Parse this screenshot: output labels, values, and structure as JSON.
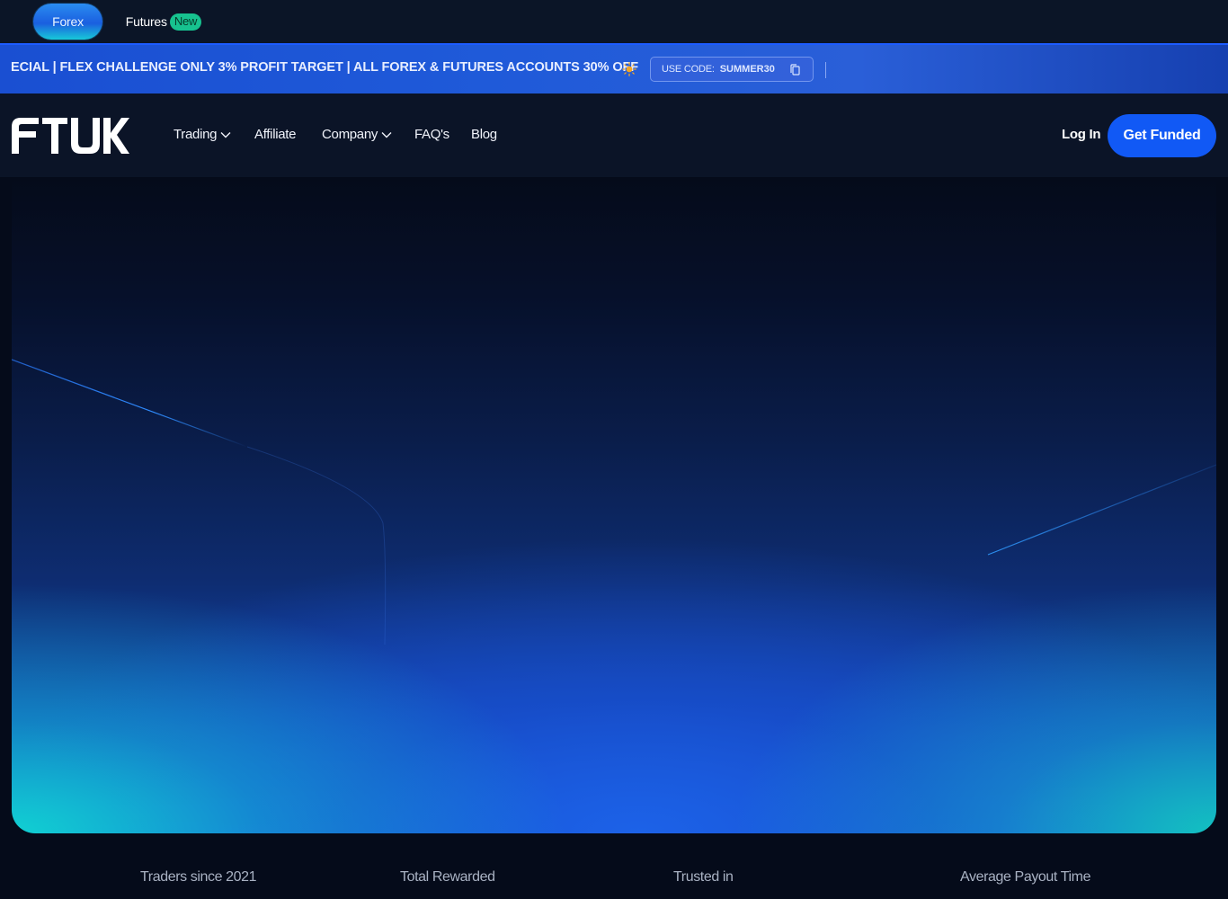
{
  "market_switcher": {
    "forex_label": "Forex",
    "futures_label": "Futures",
    "new_badge": "New"
  },
  "promo": {
    "text": "ECIAL | FLEX CHALLENGE ONLY 3% PROFIT TARGET | ALL FOREX & FUTURES ACCOUNTS 30% OFF",
    "code_label": "USE CODE:",
    "code_value": "SUMMER30",
    "sun_icon": "sun-icon",
    "copy_icon": "copy-icon"
  },
  "nav": {
    "logo_text": "FTUK",
    "items": [
      {
        "label": "Trading",
        "has_dropdown": true
      },
      {
        "label": "Affiliate",
        "has_dropdown": false
      },
      {
        "label": "Company",
        "has_dropdown": true
      },
      {
        "label": "FAQ's",
        "has_dropdown": false
      },
      {
        "label": "Blog",
        "has_dropdown": false
      }
    ],
    "login_label": "Log In",
    "cta_label": "Get Funded"
  },
  "stats": [
    {
      "label": "Traders since 2021"
    },
    {
      "label": "Total Rewarded"
    },
    {
      "label": "Trusted in"
    },
    {
      "label": "Average Payout Time"
    }
  ],
  "colors": {
    "accent": "#1159f5",
    "new_badge": "#17c28f",
    "promo_bg": "#1f5ad9",
    "page_bg": "#0a1122"
  }
}
